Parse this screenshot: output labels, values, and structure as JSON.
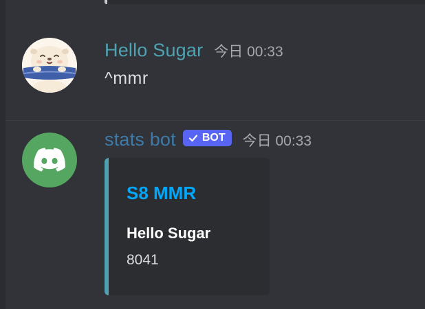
{
  "messages": [
    {
      "author": "Hello Sugar",
      "timestamp": "今日 00:33",
      "content": "^mmr",
      "avatar_icon": "otter-avatar-icon",
      "author_color": "#4fa2b1"
    },
    {
      "author": "stats bot",
      "badge": "BOT",
      "timestamp": "今日 00:33",
      "avatar_icon": "discord-logo-icon",
      "author_color": "#3d7aa9",
      "embed": {
        "title": "S8 MMR",
        "field_name": "Hello Sugar",
        "field_value": "8041",
        "accent_color": "#4fa2b1"
      }
    }
  ],
  "colors": {
    "background": "#313338",
    "embed_background": "#2b2d31",
    "badge": "#5865f2",
    "embed_title": "#00a8fc",
    "avatar_green": "#54a661"
  }
}
